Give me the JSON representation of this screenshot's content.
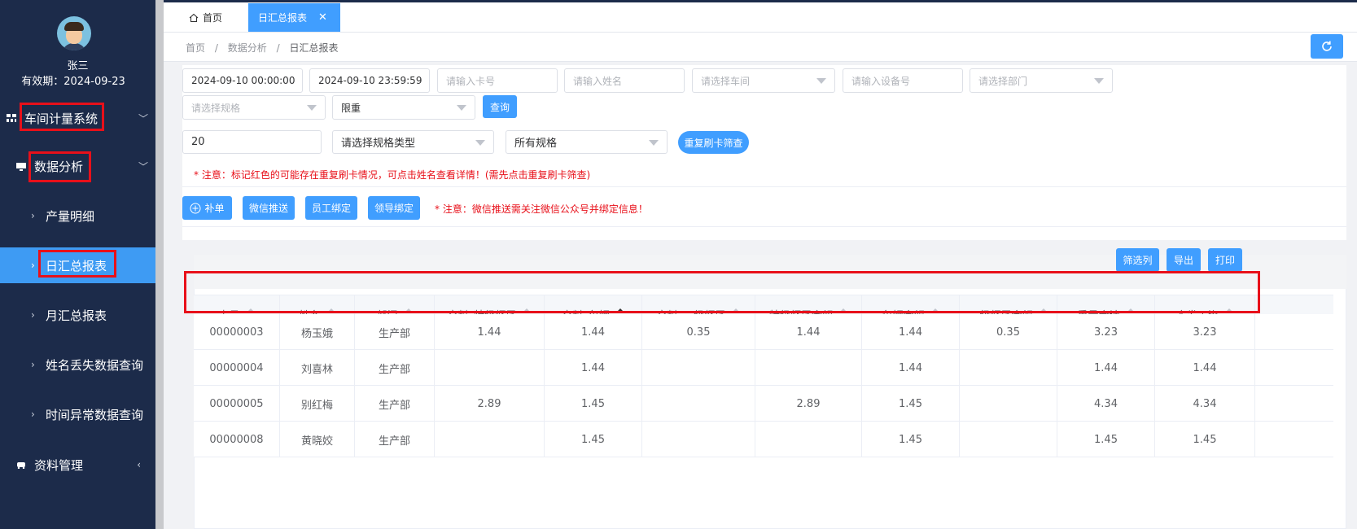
{
  "sidebar": {
    "user_name": "张三",
    "valid_until": "有效期：2024-09-23",
    "menu": [
      {
        "label": "车间计量系统",
        "icon": "grid-icon",
        "arrow": "chevron-down-icon"
      },
      {
        "label": "数据分析",
        "icon": "monitor-icon",
        "arrow": "chevron-down-icon"
      },
      {
        "label": "产量明细"
      },
      {
        "label": "日汇总报表",
        "active": true
      },
      {
        "label": "月汇总报表"
      },
      {
        "label": "姓名丢失数据查询"
      },
      {
        "label": "时间异常数据查询"
      },
      {
        "label": "资料管理",
        "icon": "car-icon",
        "arrow": "chevron-left-icon"
      }
    ]
  },
  "tabs": [
    {
      "label": "首页",
      "icon": "home-icon"
    },
    {
      "label": "日汇总报表",
      "active": true
    }
  ],
  "breadcrumb": [
    "首页",
    "数据分析",
    "日汇总报表"
  ],
  "breadcrumb_sep": "/",
  "filters": {
    "start_time": "2024-09-10 00:00:00",
    "end_time": "2024-09-10 23:59:59",
    "card_placeholder": "请输入卡号",
    "name_placeholder": "请输入姓名",
    "workshop_placeholder": "请选择车间",
    "device_placeholder": "请输入设备号",
    "department_placeholder": "请选择部门",
    "spec_placeholder": "请选择规格",
    "limit_value": "限重",
    "query_button": "查询",
    "count_value": "20",
    "spec_type_placeholder": "请选择规格类型",
    "all_specs_value": "所有规格",
    "dup_filter_button": "重复刷卡筛查"
  },
  "notice1": "* 注意：标记红色的可能存在重复刷卡情况，可点击姓名查看详情！(需先点击重复刷卡筛查)",
  "actions": {
    "add": "补单",
    "wechat_push": "微信推送",
    "employee_bind": "员工绑定",
    "leader_bind": "领导绑定",
    "notice2": "* 注意：微信推送需关注微信公众号并绑定信息！"
  },
  "table_toolbar": {
    "filter_columns": "筛选列",
    "export": "导出",
    "print": "打印"
  },
  "table": {
    "columns": [
      "卡号",
      "姓名",
      "部门",
      "交料_特级虾尾",
      "交料_鱼鳔",
      "交料_一级虾尾",
      "特级虾尾金额",
      "鱼鳔金额",
      "一级虾尾金额",
      "重量合计",
      "实发工资"
    ],
    "rows": [
      [
        "00000003",
        "杨玉娥",
        "生产部",
        "1.44",
        "1.44",
        "0.35",
        "1.44",
        "1.44",
        "0.35",
        "3.23",
        "3.23"
      ],
      [
        "00000004",
        "刘喜林",
        "生产部",
        "",
        "1.44",
        "",
        "",
        "1.44",
        "",
        "1.44",
        "1.44"
      ],
      [
        "00000005",
        "别红梅",
        "生产部",
        "2.89",
        "1.45",
        "",
        "2.89",
        "1.45",
        "",
        "4.34",
        "4.34"
      ],
      [
        "00000008",
        "黄晓姣",
        "生产部",
        "",
        "1.45",
        "",
        "",
        "1.45",
        "",
        "1.45",
        "1.45"
      ]
    ]
  },
  "colors": {
    "sidebar_bg": "#1c2b4a",
    "accent": "#409eff",
    "annotation_red": "#e8101a"
  }
}
